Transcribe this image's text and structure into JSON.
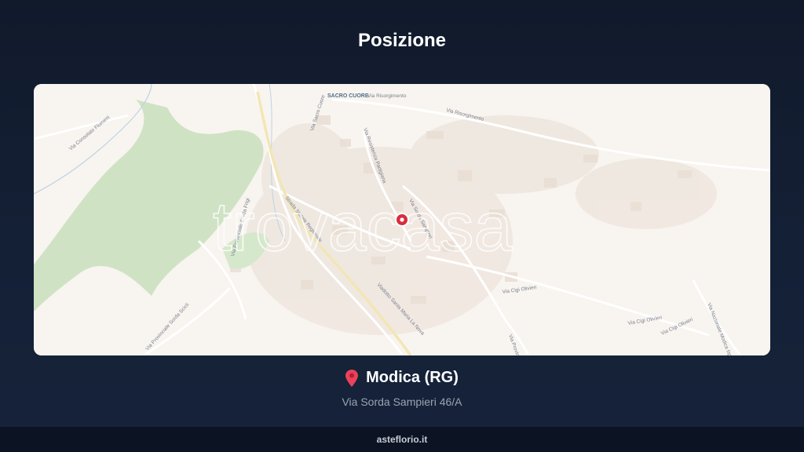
{
  "header": {
    "title": "Posizione"
  },
  "map": {
    "watermark": "trovacasa",
    "labels": {
      "place_sacro_cuore": "SACRO CUORE",
      "via_risorgimento_top": "Via Risorgimento",
      "via_risorgimento_right": "Via Risorgimento",
      "via_consolato_flumeni": "Via Consolato Flumeni",
      "via_sacro_cuore": "Via Sacro Cuore",
      "via_resistenza_partigiana": "Via Resistenza Partigiana",
      "strada_statale_regionale": "Strada Statale Regionale",
      "via_provinciale_sorda_fiume": "Via Provinciale Sorda Frigi",
      "via_sorda_sampieri_map": "Via Sorda Sampieri",
      "viadotto_santa_maria_la_nova": "Viadotto Santa Maria La Nova",
      "via_provinciale_sorda_scicli": "Via Provinciale Sorda Scicli",
      "via_cigi_olivieri_1": "Via Cigi Olivieri",
      "via_cigi_olivieri_2": "Via Cigi Olivieri",
      "via_cigi_olivieri_3": "Via Cigi Olivieri",
      "via_nazionale_modica_ispica": "Via Nazionale Modica Ispica",
      "via_provinciale_bottom": "Via Provinciale"
    },
    "colors": {
      "marker": "#d92b3f",
      "green_area": "#cfe3c4",
      "background": "#f8f4ef"
    }
  },
  "location": {
    "pin_icon": "map-pin",
    "city": "Modica (RG)",
    "address": "Via Sorda Sampieri 46/A"
  },
  "footer": {
    "site": "asteflorio.it"
  }
}
